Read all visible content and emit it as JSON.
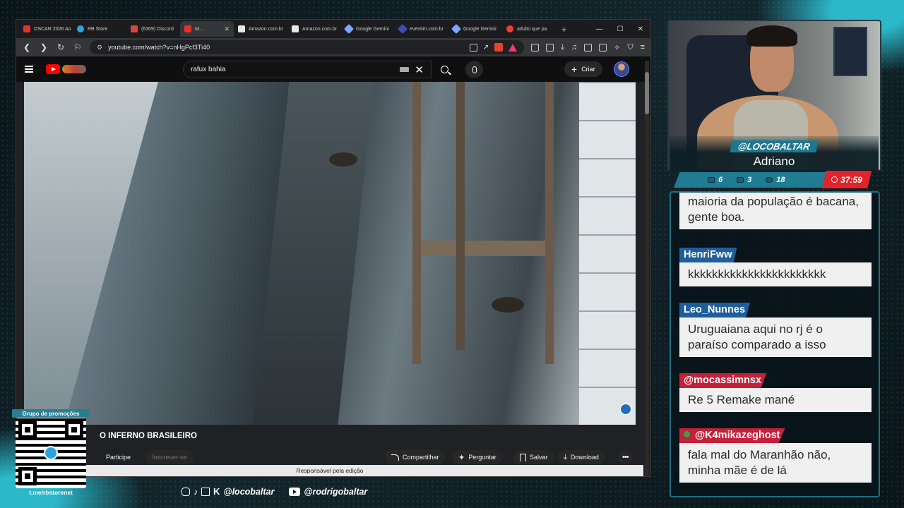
{
  "browser": {
    "tabs": [
      {
        "label": "OSCAR 2026 Ao",
        "color": "#e8312a",
        "active": false
      },
      {
        "label": "RB Store",
        "color": "#2aa4e0",
        "active": false
      },
      {
        "label": "(6309) Discord",
        "color": "#d9453a",
        "active": false
      },
      {
        "label": "M...",
        "color": "#e8312a",
        "active": true
      },
      {
        "label": "Amazon.com.br",
        "color": "#e6e6e6",
        "active": false
      },
      {
        "label": "Amazon.com.br",
        "color": "#e6e6e6",
        "active": false
      },
      {
        "label": "Google Gemini",
        "color": "#7aa8ff",
        "active": false
      },
      {
        "label": "eventim.com.br",
        "color": "#3a4fb0",
        "active": false
      },
      {
        "label": "Google Gemini",
        "color": "#7aa8ff",
        "active": false
      },
      {
        "label": "adulto que pa",
        "color": "#ea4335",
        "active": false
      }
    ],
    "url": "youtube.com/watch?v=nHgPcf3Ti40"
  },
  "youtube": {
    "search_query": "rafux bahia",
    "create_label": "Criar",
    "channel_title": "O INFERNO BRASILEIRO",
    "join_label": "Participe",
    "subscribe_label": "Inscrever-se",
    "share_label": "Compartilhar",
    "ask_label": "Perguntar",
    "save_label": "Salvar",
    "download_label": "Download",
    "more_label": "•••",
    "tooltip": "Responsável pela edição"
  },
  "overlay": {
    "handle": "@LOCOBALTAR",
    "name": "Adriano",
    "stats": {
      "messages": "6",
      "youtube": "3",
      "other": "18"
    },
    "timer": "37:59"
  },
  "chat": {
    "messages": [
      {
        "user": "",
        "color": "",
        "text": "maioria da população é bacana, gente boa."
      },
      {
        "user": "HenriFww",
        "color": "#1f5e9c",
        "text": "kkkkkkkkkkkkkkkkkkkkkkk"
      },
      {
        "user": "Leo_Nunnes",
        "color": "#1f5e9c",
        "text": "Uruguaiana aqui no rj é o paraíso comparado a isso"
      },
      {
        "user": "@mocassimnsx",
        "color": "#c4203a",
        "text": "Re 5 Remake mané"
      },
      {
        "user": "@K4mikazeghost",
        "color": "#c4203a",
        "text": "fala mal do Maranhão não, minha mãe é de lá"
      }
    ]
  },
  "promo": {
    "title": "Grupo de promoções",
    "link": "t.me/rbstorenet"
  },
  "socials": {
    "handle1": "@locobaltar",
    "handle2": "@rodrigobaltar"
  }
}
